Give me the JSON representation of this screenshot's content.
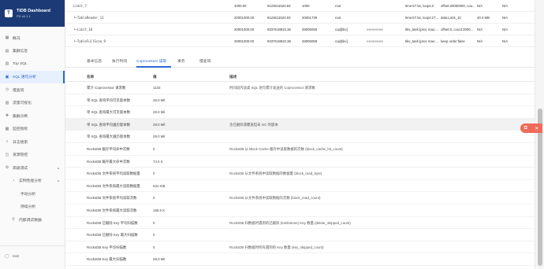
{
  "brand": {
    "title": "TiDB Dashboard",
    "version": "PD v6.1.1",
    "logo_icon": "tidb-logo"
  },
  "sidebar": {
    "items": [
      {
        "label": "概况",
        "icon": "overview-icon"
      },
      {
        "label": "集群信息",
        "icon": "cluster-info-icon"
      },
      {
        "label": "Top SQL",
        "icon": "top-sql-icon"
      },
      {
        "label": "SQL 语句分析",
        "icon": "sql-statement-icon",
        "active": true
      },
      {
        "label": "慢查询",
        "icon": "slow-query-icon"
      },
      {
        "label": "流量可视化",
        "icon": "key-visualizer-icon"
      },
      {
        "label": "集群诊断",
        "icon": "diagnose-icon"
      },
      {
        "label": "监控指标",
        "icon": "monitoring-icon"
      },
      {
        "label": "日志搜索",
        "icon": "log-search-icon"
      },
      {
        "label": "资源管控",
        "icon": "resource-icon"
      },
      {
        "label": "高级调试",
        "icon": "debug-icon",
        "chevron": "▲"
      },
      {
        "label": "实例性能分析",
        "icon": "profiling-icon",
        "chevron": "▲",
        "sub": 1
      },
      {
        "label": "手动分析",
        "sub": 2
      },
      {
        "label": "持续分析",
        "sub": 2
      },
      {
        "label": "内部调试数据",
        "icon": "debug-data-icon",
        "sub": 1
      }
    ],
    "user": "root"
  },
  "trace_rows": [
    {
      "op": "Limit_7",
      "est": "1000.00",
      "id": "9123611520.93",
      "act": "1000",
      "task": "root",
      "obj": "",
      "exec": "time:57.5s, loops:3",
      "info": "offset:20000000, cou...",
      "mem": "N/A",
      "disk": "N/A"
    },
    {
      "op": "└─TableReader_11",
      "est": "20001000.00",
      "id": "9123611520.93",
      "act": "20001739",
      "task": "root",
      "obj": "",
      "exec": "time:57.5s, loops:27...",
      "info": "data:Limit_10",
      "mem": "40.4 MB",
      "disk": "N/A"
    },
    {
      "op": "  └─Limit_10",
      "est": "20001000.00",
      "id": "9337618810.36",
      "act": "28006059",
      "task": "cop[tikv]",
      "obj": "■■■■■■■■",
      "exec": "tikv_task:{proc max:...",
      "info": "offset:0, count:2000...",
      "mem": "N/A",
      "disk": "N/A"
    },
    {
      "op": "    └─TableFullScan_9",
      "est": "20001000.00",
      "id": "9337618810.36",
      "act": "28006059",
      "task": "cop[tikv]",
      "obj": "■■■■■■■■",
      "exec": "tikv_task:{proc max:...",
      "info": "keep order:false",
      "mem": "N/A",
      "disk": "N/A"
    }
  ],
  "tabs": [
    "基本信息",
    "执行时间",
    "Coprocessor 读取",
    "事务",
    "慢查询"
  ],
  "active_tab": 2,
  "metrics": {
    "headers": {
      "name": "名称",
      "value": "值",
      "desc": "描述"
    },
    "rows": [
      {
        "name": "累计 Coprocessor 请求数",
        "value": "1133",
        "desc": "时间段内该类 SQL 语句累计发送的 Coprocessor 请求数"
      },
      {
        "name": "单 SQL 查询平均可见版本数",
        "value": "28.0 Mil",
        "desc": ""
      },
      {
        "name": "单 SQL 查询最大可见版本数",
        "value": "28.0 Mil",
        "desc": ""
      },
      {
        "name": "单 SQL 查询平均遍历版本数",
        "value": "28.0 Mil",
        "desc": "含已删除或覆盖但未 GC 的版本",
        "highlight": true
      },
      {
        "name": "单 SQL 查询最大遍历版本数",
        "value": "28.0 Mil",
        "desc": ""
      },
      {
        "name": "RocksDB 缓存平均命中次数",
        "value": "0",
        "desc": "RocksDB 从 Block Cache 缓存中读取数据的次数 (block_cache_hit_count)"
      },
      {
        "name": "RocksDB 缓存最大命中次数",
        "value": "74.4 K",
        "desc": ""
      },
      {
        "name": "RocksDB 文件系统平均读取数据量",
        "value": "0",
        "desc": "RocksDB 从文件系统中读取数据的数据量 (block_read_byte)"
      },
      {
        "name": "RocksDB 文件系统最大读取数据量",
        "value": "631 KiB",
        "desc": ""
      },
      {
        "name": "RocksDB 文件系统平均读取次数",
        "value": "0",
        "desc": "RocksDB 从文件系统中读取数据的次数 (block_read_count)"
      },
      {
        "name": "RocksDB 文件系统最大读取次数",
        "value": "155.6 K",
        "desc": ""
      },
      {
        "name": "RocksDB 已删除 Key 平均扫描数",
        "value": "0",
        "desc": "RocksDB 扫数据时遇到的已删除 (tombstone) Key 数量 (delete_skipped_count)"
      },
      {
        "name": "RocksDB 已删除 Key 最大扫描数",
        "value": "0",
        "desc": ""
      },
      {
        "name": "RocksDB Key 平均扫描数",
        "value": "0",
        "desc": "RocksDB 扫数据时所有遇到的 Key 数量 (key_skipped_count)"
      },
      {
        "name": "RocksDB Key 最大扫描数",
        "value": "28.0 Mil",
        "desc": ""
      }
    ]
  },
  "float_widget": {
    "left_icon": "copy-icon",
    "right_icon": "close-icon",
    "left_glyph": "⧉",
    "right_glyph": "✕"
  }
}
